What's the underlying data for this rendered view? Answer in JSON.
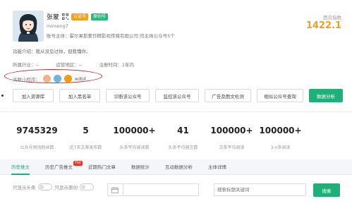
{
  "profile": {
    "name": "张蒙",
    "badge_verified": "认证号",
    "badge_original": "原创号",
    "account_id": "mimeng7",
    "subject_label": "账号主体：",
    "subject_value": "霍尔果斯蒙作精影视传媒有限公司 同主体公众号5个",
    "score_label": "西瓜指数",
    "score_value": "1422.1"
  },
  "intro": "功能介绍：我从没见过你，但我懂你。",
  "meta": {
    "industry": "所属行业：--",
    "region": "运营地区：--",
    "registered": "注册时间：1年内"
  },
  "mini_programs": {
    "label": "关联小程序：",
    "items": [
      {
        "icon": "mini-app-icon-1",
        "color": "#f4b183",
        "label": ""
      },
      {
        "icon": "mini-app-icon-2",
        "color": "#6fb3e0",
        "label": ""
      },
      {
        "icon": "mini-app-icon-3",
        "color": "#f39c12",
        "label": "AI测评"
      }
    ]
  },
  "actions": [
    {
      "label": "加入资源库",
      "primary": false,
      "w": 58
    },
    {
      "label": "加入黑名单",
      "primary": false,
      "w": 58
    },
    {
      "label": "诊断该公众号",
      "primary": false,
      "w": 62
    },
    {
      "label": "监控该公众号",
      "primary": false,
      "w": 62
    },
    {
      "label": "广告及图文检测",
      "primary": false,
      "w": 66
    },
    {
      "label": "相似公众号查询",
      "primary": false,
      "w": 66
    },
    {
      "label": "数据分析",
      "primary": true,
      "w": 48
    }
  ],
  "stats": [
    {
      "value": "9745329",
      "label": "公众号预估粉丝数"
    },
    {
      "value": "5",
      "label": "近7天文章发布数"
    },
    {
      "value": "100000+",
      "label": "头条平均阅读数"
    },
    {
      "value": "41",
      "label": "头条平均留言数"
    },
    {
      "value": "100000+",
      "label": "次条平均阅读"
    },
    {
      "value": "100000+",
      "label": "3-n条阅读"
    }
  ],
  "tabs": [
    {
      "label": "历史推文",
      "active": true,
      "hot": ""
    },
    {
      "label": "历史广告推文",
      "active": false,
      "hot": "Hot"
    },
    {
      "label": "近期热门文章",
      "active": false,
      "hot": ""
    },
    {
      "label": "数据统计",
      "active": false,
      "hot": ""
    },
    {
      "label": "互动数据分析",
      "active": false,
      "hot": ""
    },
    {
      "label": "主体详情",
      "active": false,
      "hot": ""
    }
  ],
  "filters": {
    "only_headline": "只显示头条",
    "only_original": "只显示原创",
    "search_placeholder": "搜索标题关键词",
    "search_button": "搜索"
  },
  "colors": {
    "accent": "#1fb07a",
    "score": "#f0a020",
    "hot": "#e0352b",
    "annotation": "#c0282a"
  }
}
